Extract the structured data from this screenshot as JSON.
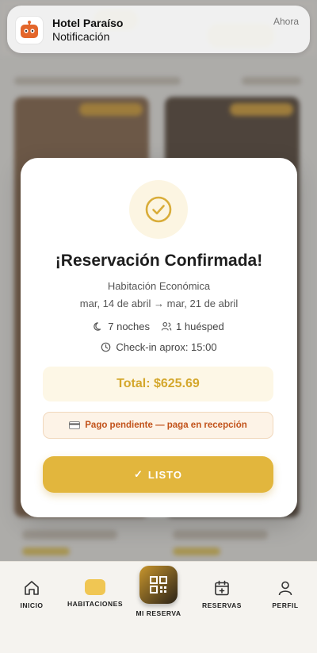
{
  "notification": {
    "title": "Hotel Paraíso",
    "body": "Notificación",
    "time": "Ahora",
    "icon": "robot-icon"
  },
  "modal": {
    "title": "¡Reservación Confirmada!",
    "room": "Habitación Económica",
    "dates": "mar, 14 de abril → mar, 21 de abril",
    "nights": "7 noches",
    "guests": "1 huésped",
    "checkin": "Check-in aprox: 15:00",
    "total": "Total: $625.69",
    "payment_status": "Pago pendiente — paga en recepción",
    "done_label": "LISTO",
    "colors": {
      "accent": "#e2b63d",
      "warning": "#c2531b"
    }
  },
  "nav": {
    "items": [
      {
        "label": "INICIO",
        "icon": "home-icon"
      },
      {
        "label": "HABITACIONES",
        "icon": "bed-icon"
      },
      {
        "label": "MI RESERVA",
        "icon": "qr-code-icon"
      },
      {
        "label": "RESERVAS",
        "icon": "calendar-plus-icon"
      },
      {
        "label": "PERFIL",
        "icon": "user-icon"
      }
    ]
  }
}
